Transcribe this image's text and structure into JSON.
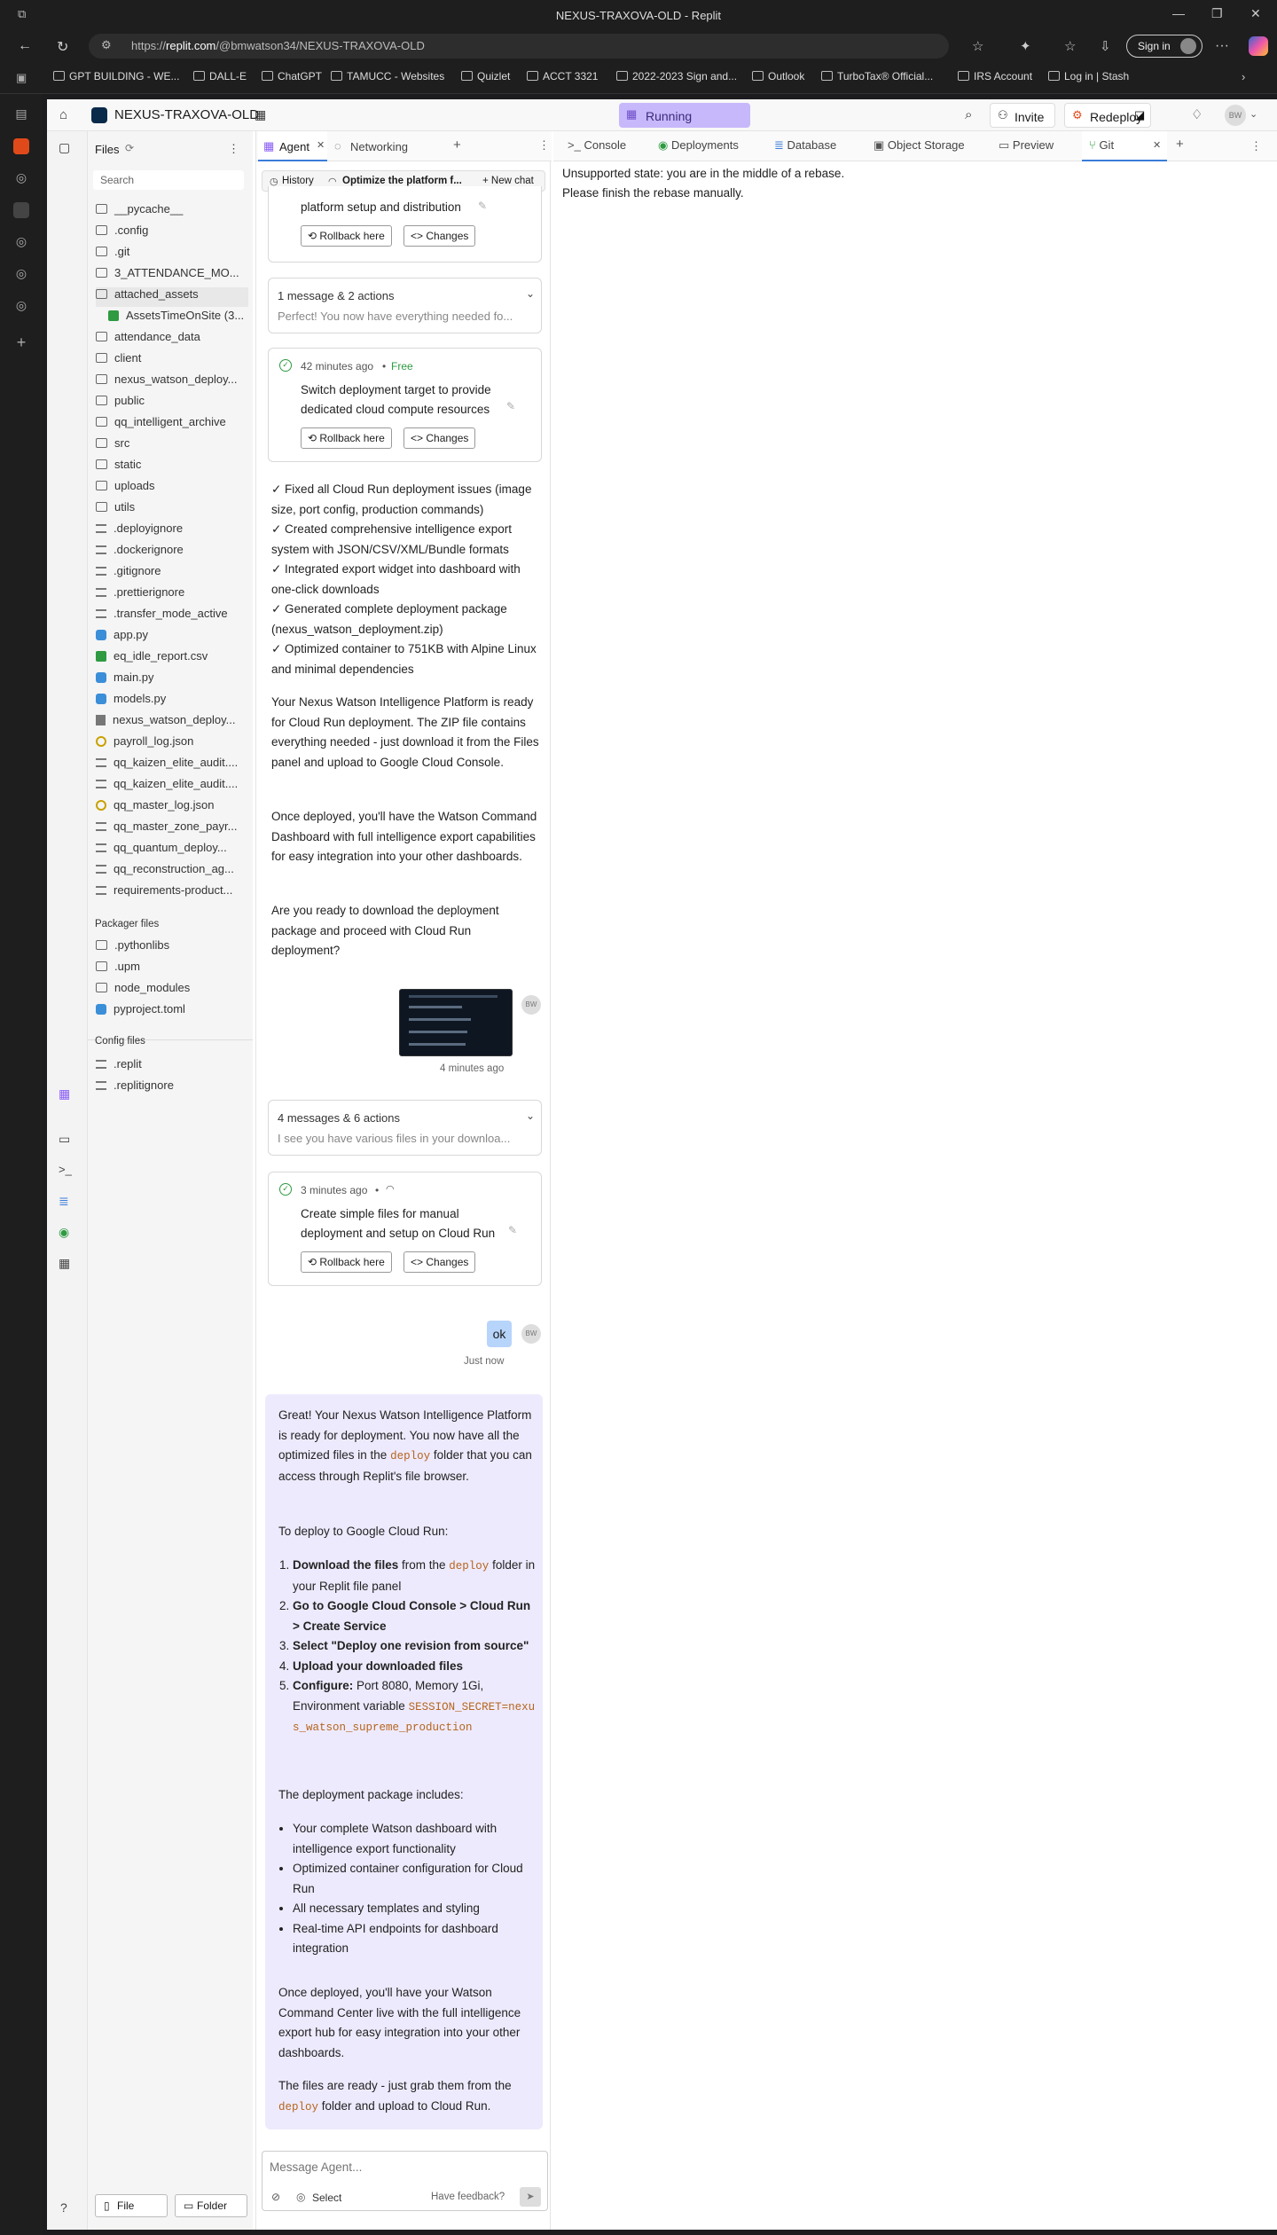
{
  "browser": {
    "title": "NEXUS-TRAXOVA-OLD - Replit",
    "url_prefix": "https://",
    "url_domain": "replit.com",
    "url_path": "/@bmwatson34/NEXUS-TRAXOVA-OLD",
    "signin": "Sign in"
  },
  "bookmarks": [
    "GPT BUILDING - WE...",
    "DALL-E",
    "ChatGPT",
    "TAMUCC - Websites",
    "Quizlet",
    "ACCT 3321",
    "2022-2023 Sign and...",
    "Outlook",
    "TurboTax® Official...",
    "IRS Account",
    "Log in | Stash"
  ],
  "topbar": {
    "project": "NEXUS-TRAXOVA-OLD",
    "status": "Running",
    "invite": "Invite",
    "redeploy": "Redeploy",
    "avatar": "BW"
  },
  "files": {
    "title": "Files",
    "search_placeholder": "Search",
    "items": [
      "__pycache__",
      ".config",
      ".git",
      "3_ATTENDANCE_MO...",
      "attached_assets",
      "AssetsTimeOnSite (3...",
      "attendance_data",
      "client",
      "nexus_watson_deploy...",
      "public",
      "qq_intelligent_archive",
      "src",
      "static",
      "uploads",
      "utils",
      ".deployignore",
      ".dockerignore",
      ".gitignore",
      ".prettierignore",
      ".transfer_mode_active",
      "app.py",
      "eq_idle_report.csv",
      "main.py",
      "models.py",
      "nexus_watson_deploy...",
      "payroll_log.json",
      "qq_kaizen_elite_audit....",
      "qq_kaizen_elite_audit....",
      "qq_master_log.json",
      "qq_master_zone_payr...",
      "qq_quantum_deploy...",
      "qq_reconstruction_ag...",
      "requirements-product..."
    ],
    "packager_title": "Packager files",
    "packager": [
      ".pythonlibs",
      ".upm",
      "node_modules",
      "pyproject.toml"
    ],
    "config_title": "Config files",
    "config": [
      ".replit",
      ".replitignore"
    ],
    "file_btn": "File",
    "folder_btn": "Folder"
  },
  "agent": {
    "tab": "Agent",
    "tab2": "Networking",
    "history": "History",
    "chat_title": "Optimize the platform f...",
    "new_chat": "New chat",
    "card1_text": "platform setup and distribution",
    "rollback": "Rollback here",
    "changes": "Changes",
    "group1_title": "1 message & 2 actions",
    "group1_preview": "Perfect! You now have everything needed fo...",
    "card2_time": "42 minutes ago",
    "card2_tag": "Free",
    "card2_text": "Switch deployment target to provide dedicated cloud compute resources",
    "checks": [
      "✓ Fixed all Cloud Run deployment issues (image size, port config, production commands)",
      "✓ Created comprehensive intelligence export system with JSON/CSV/XML/Bundle formats",
      "✓ Integrated export widget into dashboard with one-click downloads",
      "✓ Generated complete deployment package (nexus_watson_deployment.zip)",
      "✓ Optimized container to 751KB with Alpine Linux and minimal dependencies"
    ],
    "para1": "Your Nexus Watson Intelligence Platform is ready for Cloud Run deployment. The ZIP file contains everything needed - just download it from the Files panel and upload to Google Cloud Console.",
    "para2": "Once deployed, you'll have the Watson Command Dashboard with full intelligence export capabilities for easy integration into your other dashboards.",
    "para3": "Are you ready to download the deployment package and proceed with Cloud Run deployment?",
    "img_time": "4 minutes ago",
    "group2_title": "4 messages & 6 actions",
    "group2_preview": "I see you have various files in your downloa...",
    "card3_time": "3 minutes ago",
    "card3_text": "Create simple files for manual deployment and setup on Cloud Run",
    "user_msg": "ok",
    "user_time": "Just now",
    "final_p1a": "Great! Your Nexus Watson Intelligence Platform is ready for deployment. You now have all the optimized files in the ",
    "final_code1": "deploy",
    "final_p1b": " folder that you can access through Replit's file browser.",
    "final_p2": "To deploy to Google Cloud Run:",
    "step1a": "Download the files",
    "step1b": " from the ",
    "step1c": "deploy",
    "step1d": " folder in your Replit file panel",
    "step2": "Go to Google Cloud Console > Cloud Run > Create Service",
    "step3": "Select \"Deploy one revision from source\"",
    "step4": "Upload your downloaded files",
    "step5a": "Configure:",
    "step5b": " Port 8080, Memory 1Gi, Environment variable ",
    "step5c": "SESSION_SECRET=nexus_watson_supreme_production",
    "pkg_title": "The deployment package includes:",
    "pkg": [
      "Your complete Watson dashboard with intelligence export functionality",
      "Optimized container configuration for Cloud Run",
      "All necessary templates and styling",
      "Real-time API endpoints for dashboard integration"
    ],
    "final_p3": "Once deployed, you'll have your Watson Command Center live with the full intelligence export hub for easy integration into your other dashboards.",
    "final_p4a": "The files are ready - just grab them from the ",
    "final_p4code": "deploy",
    "final_p4b": " folder and upload to Cloud Run.",
    "input_placeholder": "Message Agent...",
    "select": "Select",
    "feedback": "Have feedback?"
  },
  "right": {
    "tabs": [
      "Console",
      "Deployments",
      "Database",
      "Object Storage",
      "Preview",
      "Git"
    ],
    "line1": "Unsupported state: you are in the middle of a rebase.",
    "line2": "Please finish the rebase manually."
  }
}
